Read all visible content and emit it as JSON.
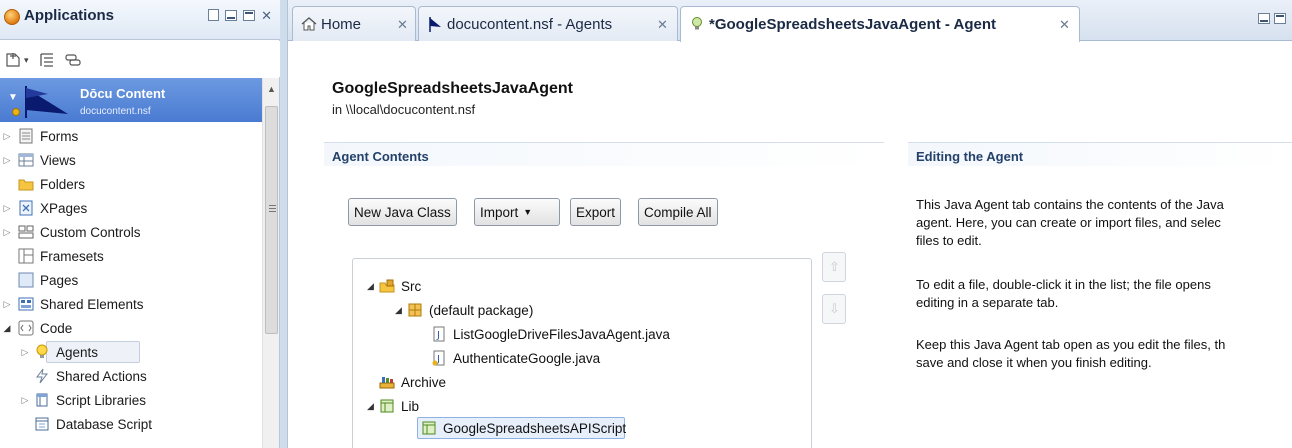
{
  "left_panel": {
    "title": "Applications",
    "toolbar_icons": [
      "new-app-icon",
      "outline-icon",
      "link-icon"
    ],
    "database": {
      "title": "Dōcu Content",
      "filename": "docucontent.nsf"
    },
    "tree": [
      {
        "label": "Forms",
        "icon": "forms-icon",
        "expander": "collapsed"
      },
      {
        "label": "Views",
        "icon": "views-icon",
        "expander": "collapsed"
      },
      {
        "label": "Folders",
        "icon": "folder-icon",
        "expander": "none"
      },
      {
        "label": "XPages",
        "icon": "xpages-icon",
        "expander": "collapsed"
      },
      {
        "label": "Custom Controls",
        "icon": "custom-controls-icon",
        "expander": "collapsed"
      },
      {
        "label": "Framesets",
        "icon": "framesets-icon",
        "expander": "none"
      },
      {
        "label": "Pages",
        "icon": "pages-icon",
        "expander": "none"
      },
      {
        "label": "Shared Elements",
        "icon": "shared-elements-icon",
        "expander": "collapsed"
      },
      {
        "label": "Code",
        "icon": "code-icon",
        "expander": "expanded"
      },
      {
        "label": "Agents",
        "icon": "agents-bulb-icon",
        "expander": "collapsed",
        "selected": true
      },
      {
        "label": "Shared Actions",
        "icon": "shared-actions-icon",
        "expander": "none"
      },
      {
        "label": "Script Libraries",
        "icon": "script-libraries-icon",
        "expander": "collapsed"
      },
      {
        "label": "Database Script",
        "icon": "database-script-icon",
        "expander": "none"
      }
    ]
  },
  "tabs": [
    {
      "label": "Home",
      "icon": "home-icon",
      "active": false
    },
    {
      "label": "docucontent.nsf - Agents",
      "icon": "flag-icon",
      "active": false
    },
    {
      "label": "*GoogleSpreadsheetsJavaAgent - Agent",
      "icon": "bulb-icon",
      "active": true
    }
  ],
  "editor": {
    "agent_name": "GoogleSpreadsheetsJavaAgent",
    "agent_path": "in \\\\local\\docucontent.nsf",
    "contents_heading": "Agent Contents",
    "buttons": {
      "new_java_class": "New Java Class",
      "import": "Import",
      "export": "Export",
      "compile_all": "Compile All"
    },
    "file_tree": [
      {
        "label": "Src",
        "icon": "src-folder-icon",
        "depth": 0,
        "expander": "expanded"
      },
      {
        "label": "(default package)",
        "icon": "package-icon",
        "depth": 1,
        "expander": "expanded"
      },
      {
        "label": "ListGoogleDriveFilesJavaAgent.java",
        "icon": "java-file-icon",
        "depth": 2,
        "expander": "none"
      },
      {
        "label": "AuthenticateGoogle.java",
        "icon": "java-file-icon",
        "depth": 2,
        "expander": "none"
      },
      {
        "label": "Archive",
        "icon": "archive-icon",
        "depth": 0,
        "expander": "none"
      },
      {
        "label": "Lib",
        "icon": "lib-icon",
        "depth": 0,
        "expander": "expanded"
      },
      {
        "label": "GoogleSpreadsheetsAPIScript",
        "icon": "script-lib-icon",
        "depth": 1,
        "expander": "none",
        "selected": true
      }
    ],
    "help": {
      "heading": "Editing the Agent",
      "paragraphs": [
        [
          "This Java Agent tab contains the contents of the Java",
          "agent. Here, you can create or import files, and selec",
          "files to edit."
        ],
        [
          "To edit a file, double-click it in the list; the file opens",
          "editing in a separate tab."
        ],
        [
          "Keep this Java Agent tab open as you edit the files, th",
          "save and close it when you finish editing."
        ]
      ]
    }
  },
  "colors": {
    "selection_blue": "#4a7bd2",
    "tab_border": "#a9bbd2",
    "heading_blue": "#24416b"
  }
}
